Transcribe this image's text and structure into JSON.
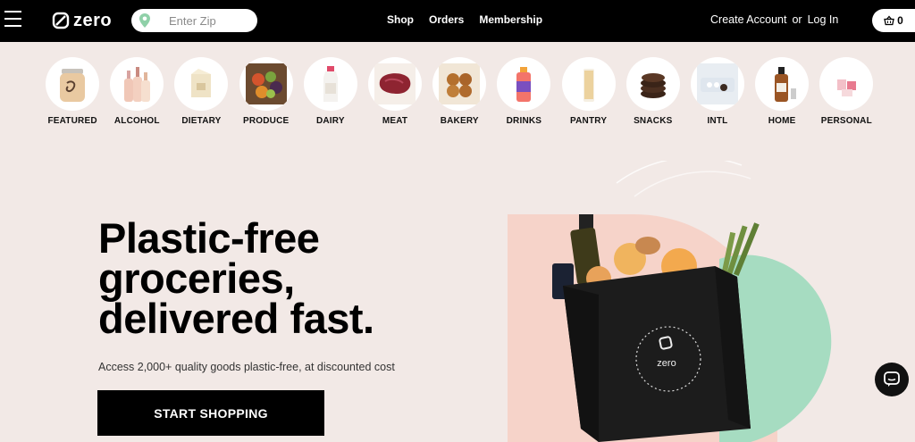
{
  "header": {
    "logo_text": "zero",
    "zip_placeholder": "Enter Zip",
    "nav": [
      {
        "label": "Shop"
      },
      {
        "label": "Orders"
      },
      {
        "label": "Membership"
      }
    ],
    "create_account": "Create Account",
    "or": "or",
    "log_in": "Log In",
    "cart_count": "0"
  },
  "categories": [
    {
      "label": "FEATURED",
      "icon": "jar-icon"
    },
    {
      "label": "ALCOHOL",
      "icon": "wine-bottles-icon"
    },
    {
      "label": "DIETARY",
      "icon": "dietary-box-icon"
    },
    {
      "label": "PRODUCE",
      "icon": "produce-box-icon"
    },
    {
      "label": "DAIRY",
      "icon": "milk-bottle-icon"
    },
    {
      "label": "MEAT",
      "icon": "steak-icon"
    },
    {
      "label": "BAKERY",
      "icon": "bread-rolls-icon"
    },
    {
      "label": "DRINKS",
      "icon": "drink-bottle-icon"
    },
    {
      "label": "PANTRY",
      "icon": "pasta-jar-icon"
    },
    {
      "label": "SNACKS",
      "icon": "cookies-icon"
    },
    {
      "label": "INTL",
      "icon": "intl-tray-icon"
    },
    {
      "label": "HOME",
      "icon": "amber-bottle-icon"
    },
    {
      "label": "PERSONAL",
      "icon": "personal-care-icon"
    }
  ],
  "hero": {
    "title_line1": "Plastic-free",
    "title_line2": "groceries,",
    "title_line3": "delivered fast.",
    "subtitle": "Access 2,000+ quality goods plastic-free, at discounted cost",
    "cta": "START SHOPPING",
    "bag_text": "zero"
  },
  "colors": {
    "background": "#f2e9e6",
    "header": "#000000",
    "blob_pink": "#f6d3c9",
    "blob_green": "#a6dcc1"
  }
}
